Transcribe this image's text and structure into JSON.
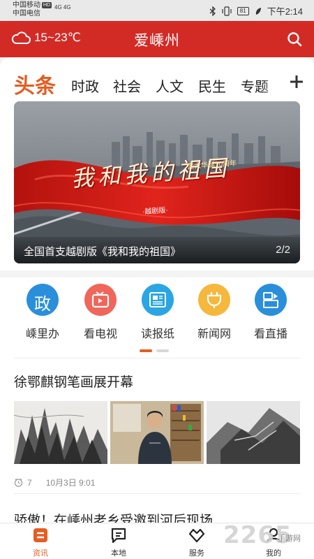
{
  "status_bar": {
    "carrier_1": "中国移动",
    "carrier_1_badge": "HD",
    "carrier_2": "中国电信",
    "signal": "4G 4G",
    "battery": "81",
    "time": "下午2:14"
  },
  "header": {
    "weather": "15~23℃",
    "title": "爱嵊州",
    "weather_icon": "cloud-icon",
    "search_icon": "search-icon"
  },
  "tabs": [
    {
      "label": "头条"
    },
    {
      "label": "时政"
    },
    {
      "label": "社会"
    },
    {
      "label": "人文"
    },
    {
      "label": "民生"
    },
    {
      "label": "专题"
    }
  ],
  "banner": {
    "art_title": "我和我的祖国",
    "art_subtitle": "盛大华诞70周年",
    "art_tag": "·越剧版·",
    "caption": "全国首支越剧版《我和我的祖国》",
    "pager": "2/2"
  },
  "quick_links": [
    {
      "label": "嵊里办",
      "glyph": "政",
      "color": "#2a8fdb"
    },
    {
      "label": "看电视",
      "glyph": "tv-icon",
      "color": "#f0665a"
    },
    {
      "label": "读报纸",
      "glyph": "newspaper-icon",
      "color": "#2aa6e3"
    },
    {
      "label": "新闻网",
      "glyph": "plug-icon",
      "color": "#f5b83d"
    },
    {
      "label": "看直播",
      "glyph": "live-icon",
      "color": "#2a8fdb"
    }
  ],
  "colors": {
    "brand_red": "#d22b26",
    "accent_orange": "#e55d22"
  },
  "article_1": {
    "title": "徐鄂麒钢笔画展开幕",
    "views": "7",
    "date": "10月3日 9:01"
  },
  "article_2": {
    "title": "骄傲！在嵊州老乡受邀到河后现场"
  },
  "bottom_nav": [
    {
      "label": "资讯"
    },
    {
      "label": "本地"
    },
    {
      "label": "服务"
    },
    {
      "label": "我的"
    }
  ],
  "watermark": {
    "big": "2265",
    "small": "手游网"
  }
}
